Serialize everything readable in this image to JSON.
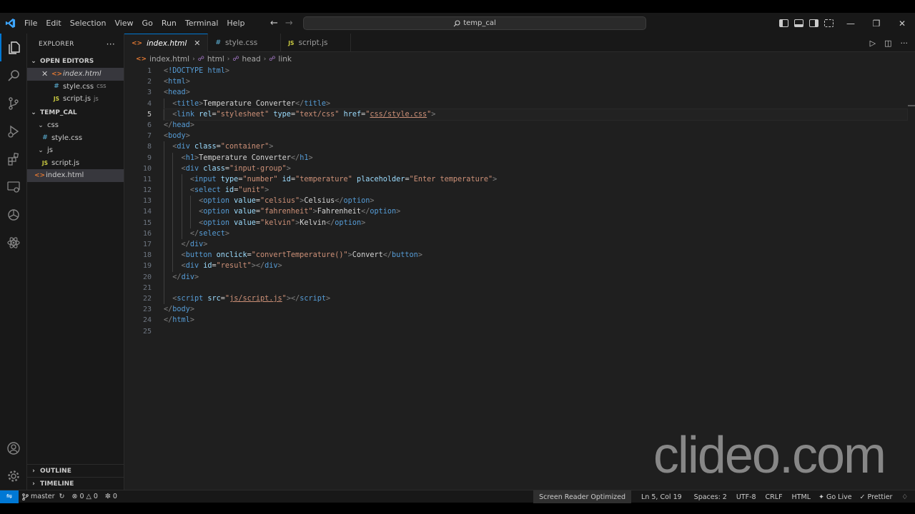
{
  "menu": [
    "File",
    "Edit",
    "Selection",
    "View",
    "Go",
    "Run",
    "Terminal",
    "Help"
  ],
  "command_center": "temp_cal",
  "explorer": {
    "title": "EXPLORER",
    "open_editors_label": "OPEN EDITORS",
    "open_editors": [
      {
        "name": "index.html",
        "hint": ""
      },
      {
        "name": "style.css",
        "hint": "css"
      },
      {
        "name": "script.js",
        "hint": "js"
      }
    ],
    "folder": "TEMP_CAL",
    "tree": {
      "css_folder": "css",
      "css_file": "style.css",
      "js_folder": "js",
      "js_file": "script.js",
      "root_file": "index.html"
    },
    "outline_label": "OUTLINE",
    "timeline_label": "TIMELINE"
  },
  "tabs": [
    {
      "name": "index.html",
      "icon": "<>"
    },
    {
      "name": "style.css",
      "icon": "#"
    },
    {
      "name": "script.js",
      "icon": "JS"
    }
  ],
  "breadcrumb": [
    "index.html",
    "html",
    "head",
    "link"
  ],
  "editor": {
    "current_line": 5,
    "lines": [
      "1",
      "2",
      "3",
      "4",
      "5",
      "6",
      "7",
      "8",
      "9",
      "10",
      "11",
      "12",
      "13",
      "14",
      "15",
      "16",
      "17",
      "18",
      "19",
      "20",
      "21",
      "22",
      "23",
      "24",
      "25"
    ],
    "code": {
      "l1_tag": "!DOCTYPE",
      "l1_kw": "html",
      "l2": "html",
      "l3": "head",
      "l4_tag": "title",
      "l4_text": "Temperature Converter",
      "l5_tag": "link",
      "l5_a1": "rel",
      "l5_v1": "\"stylesheet\"",
      "l5_a2": "type",
      "l5_v2": "\"text/css\"",
      "l5_a3": "href",
      "l5_v3a": "\"",
      "l5_v3b": "css/style.css",
      "l5_v3c": "\"",
      "l6": "head",
      "l7": "body",
      "l8_tag": "div",
      "l8_a": "class",
      "l8_v": "\"container\"",
      "l9_tag": "h1",
      "l9_text": "Temperature Converter",
      "l10_tag": "div",
      "l10_a": "class",
      "l10_v": "\"input-group\"",
      "l11_tag": "input",
      "l11_a1": "type",
      "l11_v1": "\"number\"",
      "l11_a2": "id",
      "l11_v2": "\"temperature\"",
      "l11_a3": "placeholder",
      "l11_v3": "\"Enter temperature\"",
      "l12_tag": "select",
      "l12_a": "id",
      "l12_v": "\"unit\"",
      "opt_tag": "option",
      "opt_a": "value",
      "l13_v": "\"celsius\"",
      "l13_text": "Celsius",
      "l14_v": "\"fahrenheit\"",
      "l14_text": "Fahrenheit",
      "l15_v": "\"kelvin\"",
      "l15_text": "Kelvin",
      "l16": "select",
      "l17": "div",
      "l18_tag": "button",
      "l18_a": "onclick",
      "l18_v": "\"convertTemperature()\"",
      "l18_text": "Convert",
      "l19_tag": "div",
      "l19_a": "id",
      "l19_v": "\"result\"",
      "l20": "div",
      "l22_tag": "script",
      "l22_a": "src",
      "l22_v1": "\"",
      "l22_v2": "js/script.js",
      "l22_v3": "\"",
      "l23": "body",
      "l24": "html"
    }
  },
  "status": {
    "branch": "master",
    "errors": "0",
    "warnings": "0",
    "ports": "0",
    "screen_reader": "Screen Reader Optimized",
    "cursor": "Ln 5, Col 19",
    "spaces": "Spaces: 2",
    "encoding": "UTF-8",
    "eol": "CRLF",
    "language": "HTML",
    "go_live": "Go Live",
    "prettier": "Prettier"
  },
  "watermark": "clideo.com",
  "colors": {
    "accent": "#0078d4",
    "tag": "#569cd6",
    "attr": "#9cdcfe",
    "string": "#ce9178",
    "html_icon": "#e37933",
    "css_icon": "#519aba",
    "js_icon": "#cbcb41"
  }
}
